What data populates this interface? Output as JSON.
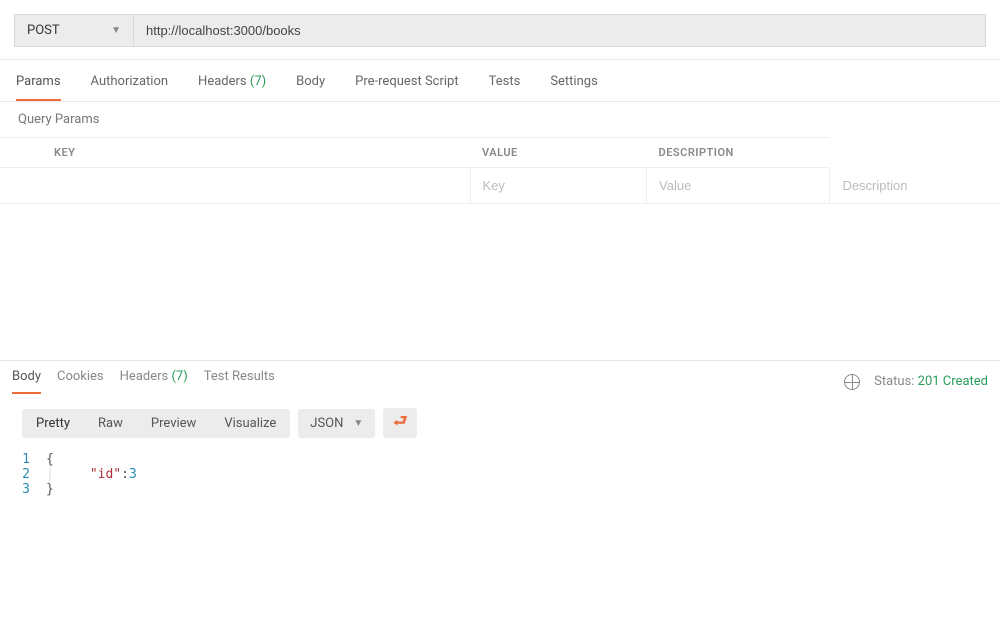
{
  "request": {
    "method": "POST",
    "url": "http://localhost:3000/books"
  },
  "request_tabs": {
    "params": "Params",
    "authorization": "Authorization",
    "headers": "Headers",
    "headers_count": "(7)",
    "body": "Body",
    "prerequest": "Pre-request Script",
    "tests": "Tests",
    "settings": "Settings"
  },
  "query_params": {
    "section_label": "Query Params",
    "headers": {
      "key": "KEY",
      "value": "VALUE",
      "description": "DESCRIPTION"
    },
    "placeholders": {
      "key": "Key",
      "value": "Value",
      "description": "Description"
    }
  },
  "response_tabs": {
    "body": "Body",
    "cookies": "Cookies",
    "headers": "Headers",
    "headers_count": "(7)",
    "test_results": "Test Results"
  },
  "response_status": {
    "label": "Status:",
    "value": "201 Created"
  },
  "format_bar": {
    "pretty": "Pretty",
    "raw": "Raw",
    "preview": "Preview",
    "visualize": "Visualize",
    "json": "JSON"
  },
  "response_body": {
    "lines": [
      {
        "n": "1",
        "open": "{"
      },
      {
        "n": "2",
        "key": "\"id\"",
        "colon": ": ",
        "val": "3"
      },
      {
        "n": "3",
        "close": "}"
      }
    ]
  }
}
